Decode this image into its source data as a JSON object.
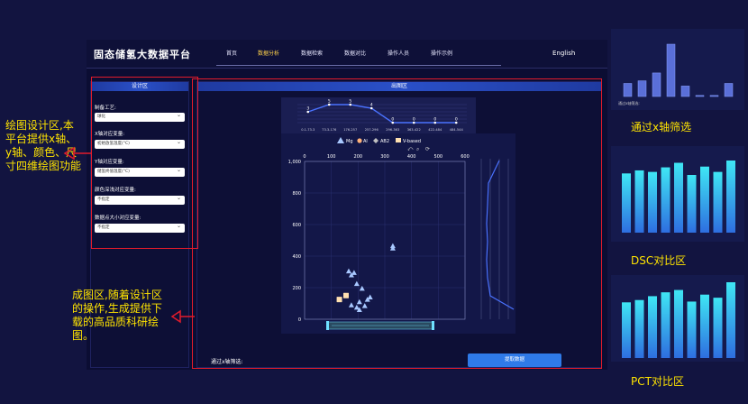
{
  "app": {
    "title": "固态储氢大数据平台",
    "nav": [
      "首页",
      "数据分析",
      "数据检索",
      "数据对比",
      "操作人员",
      "操作示例"
    ],
    "nav_active": 1,
    "language": "English"
  },
  "design_panel": {
    "title": "设计区",
    "fields": [
      {
        "label": "制备工艺:",
        "value": "球化"
      },
      {
        "label": "X轴对应变量:",
        "value": "初始放氢温度(°C)"
      },
      {
        "label": "Y轴对应变量:",
        "value": "储氢终值温度(°C)"
      },
      {
        "label": "颜色深浅对应变量:",
        "value": "不指定"
      },
      {
        "label": "数据点大小对应变量:",
        "value": "不指定"
      }
    ]
  },
  "chart_panel": {
    "title": "出图区",
    "x_filter_label": "通过x轴筛选:",
    "extract_button": "提取数据",
    "toolbar_icons": [
      "restore-icon",
      "zoom-icon",
      "refresh-icon"
    ]
  },
  "annotations": {
    "left_top": "绘图设计区,本平台提供x轴、y轴、颜色、尺寸四维绘图功能",
    "left_bottom": "成图区,随着设计区的操作,生成提供下载的高品质科研绘图。",
    "right_top": "通过x轴筛选",
    "right_mid": "DSC对比区",
    "right_bottom": "PCT对比区",
    "thumb_caption": "通过x轴筛选:"
  },
  "colors": {
    "accent": "#2f7ae8",
    "annotation": "#ffe400",
    "highlight_border": "#e21b2b",
    "bar": "#5a6fd8"
  },
  "chart_data": [
    {
      "type": "scatter",
      "legend": [
        "Mg",
        "Al",
        "AB2",
        "V-based"
      ],
      "x_ticks": [
        0,
        100,
        200,
        300,
        400,
        500,
        600
      ],
      "y_ticks": [
        0,
        200,
        400,
        600,
        800,
        "1,000"
      ],
      "xlim": [
        0,
        600
      ],
      "ylim": [
        0,
        1000
      ],
      "series": [
        {
          "name": "Mg",
          "marker": "triangle",
          "color": "#a8c8ff",
          "points": [
            [
              330,
              450
            ],
            [
              330,
              465
            ],
            [
              165,
              305
            ],
            [
              175,
              280
            ],
            [
              185,
              295
            ],
            [
              195,
              225
            ],
            [
              215,
              195
            ],
            [
              245,
              140
            ],
            [
              235,
              125
            ],
            [
              205,
              110
            ],
            [
              175,
              90
            ],
            [
              195,
              75
            ],
            [
              225,
              85
            ],
            [
              205,
              60
            ]
          ]
        },
        {
          "name": "Al",
          "marker": "circle",
          "color": "#ffb27a",
          "points": []
        },
        {
          "name": "AB2",
          "marker": "diamond",
          "color": "#c0c0c0",
          "points": []
        },
        {
          "name": "V-based",
          "marker": "square",
          "color": "#ffe0b0",
          "points": [
            [
              155,
              150
            ],
            [
              130,
              125
            ]
          ]
        }
      ]
    },
    {
      "type": "line",
      "categories": [
        "0.1-73.3",
        "73.3-176",
        "176-257",
        "257-296",
        "296-363",
        "363-422",
        "422-484",
        "484-544"
      ],
      "values": [
        3,
        5,
        5,
        4,
        0,
        0,
        0,
        0
      ]
    }
  ]
}
